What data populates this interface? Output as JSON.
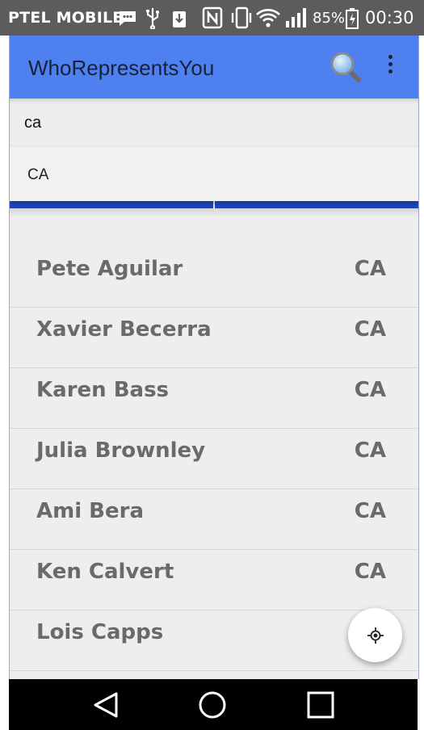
{
  "status_bar": {
    "carrier": "PTEL MOBILE",
    "battery_percent": "85%",
    "time": "00:30",
    "icons": [
      "message-icon",
      "usb-icon",
      "download-icon",
      "nfc-icon",
      "vibrate-icon",
      "wifi-icon",
      "signal-icon",
      "battery-charging-icon"
    ]
  },
  "app_bar": {
    "title": "WhoRepresentsYou",
    "color": "#4f80f0",
    "search_icon": "search-icon",
    "menu_icon": "more-vert-icon"
  },
  "search": {
    "value": "ca",
    "suggestion": "CA"
  },
  "tabs": {
    "accent": "#1c47c9",
    "count": 2
  },
  "representatives": [
    {
      "name": "Pete Aguilar",
      "state": "CA"
    },
    {
      "name": "Xavier Becerra",
      "state": "CA"
    },
    {
      "name": "Karen Bass",
      "state": "CA"
    },
    {
      "name": "Julia Brownley",
      "state": "CA"
    },
    {
      "name": "Ami Bera",
      "state": "CA"
    },
    {
      "name": "Ken Calvert",
      "state": "CA"
    },
    {
      "name": "Lois Capps",
      "state": ""
    }
  ],
  "fab": {
    "icon": "my-location-icon"
  },
  "nav_bar": {
    "icons": [
      "back-icon",
      "home-icon",
      "recents-icon"
    ]
  }
}
